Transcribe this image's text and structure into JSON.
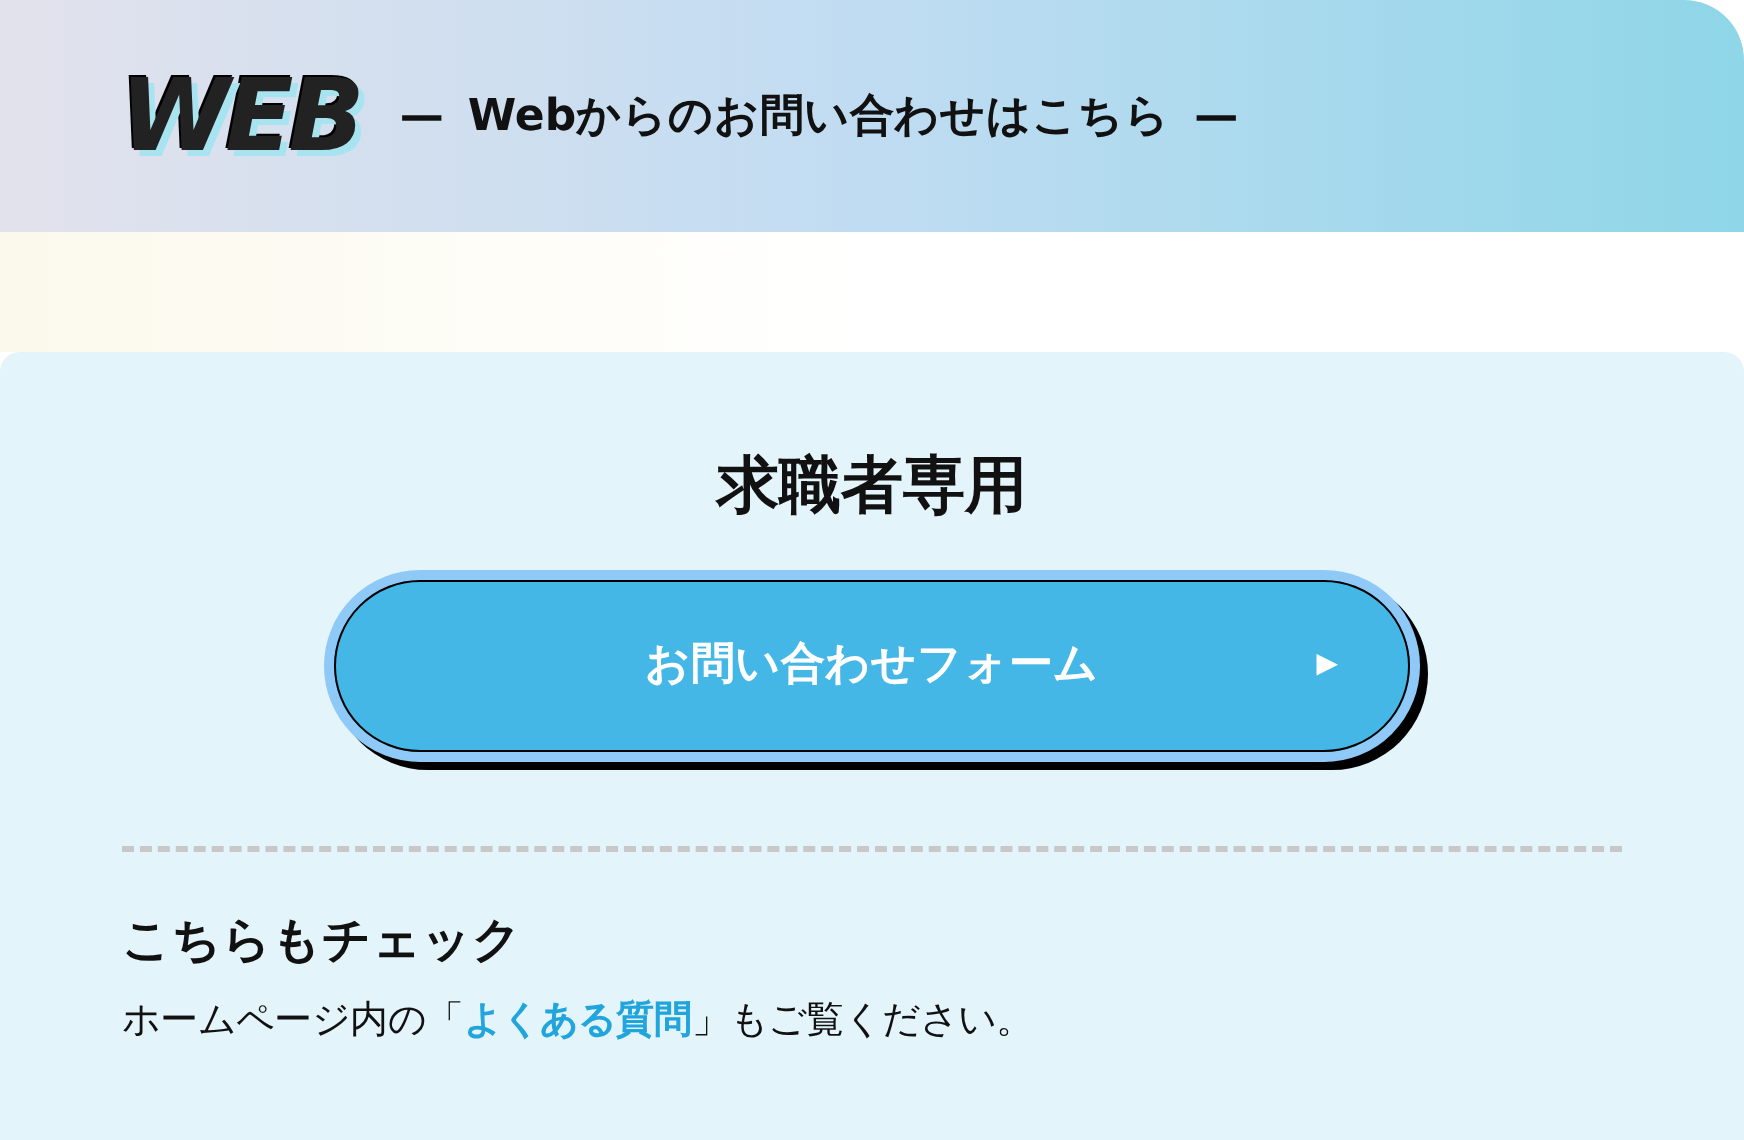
{
  "header": {
    "logo": "WEB",
    "dash_left": "—",
    "subtitle": "Webからのお問い合わせはこちら",
    "dash_right": "—"
  },
  "card": {
    "title": "求職者専用",
    "button": {
      "label": "お問い合わせフォーム",
      "arrow": "▶"
    },
    "check": {
      "heading": "こちらもチェック",
      "before": "ホームページ内の「",
      "link": "よくある質問",
      "after": "」もご覧ください。"
    }
  }
}
